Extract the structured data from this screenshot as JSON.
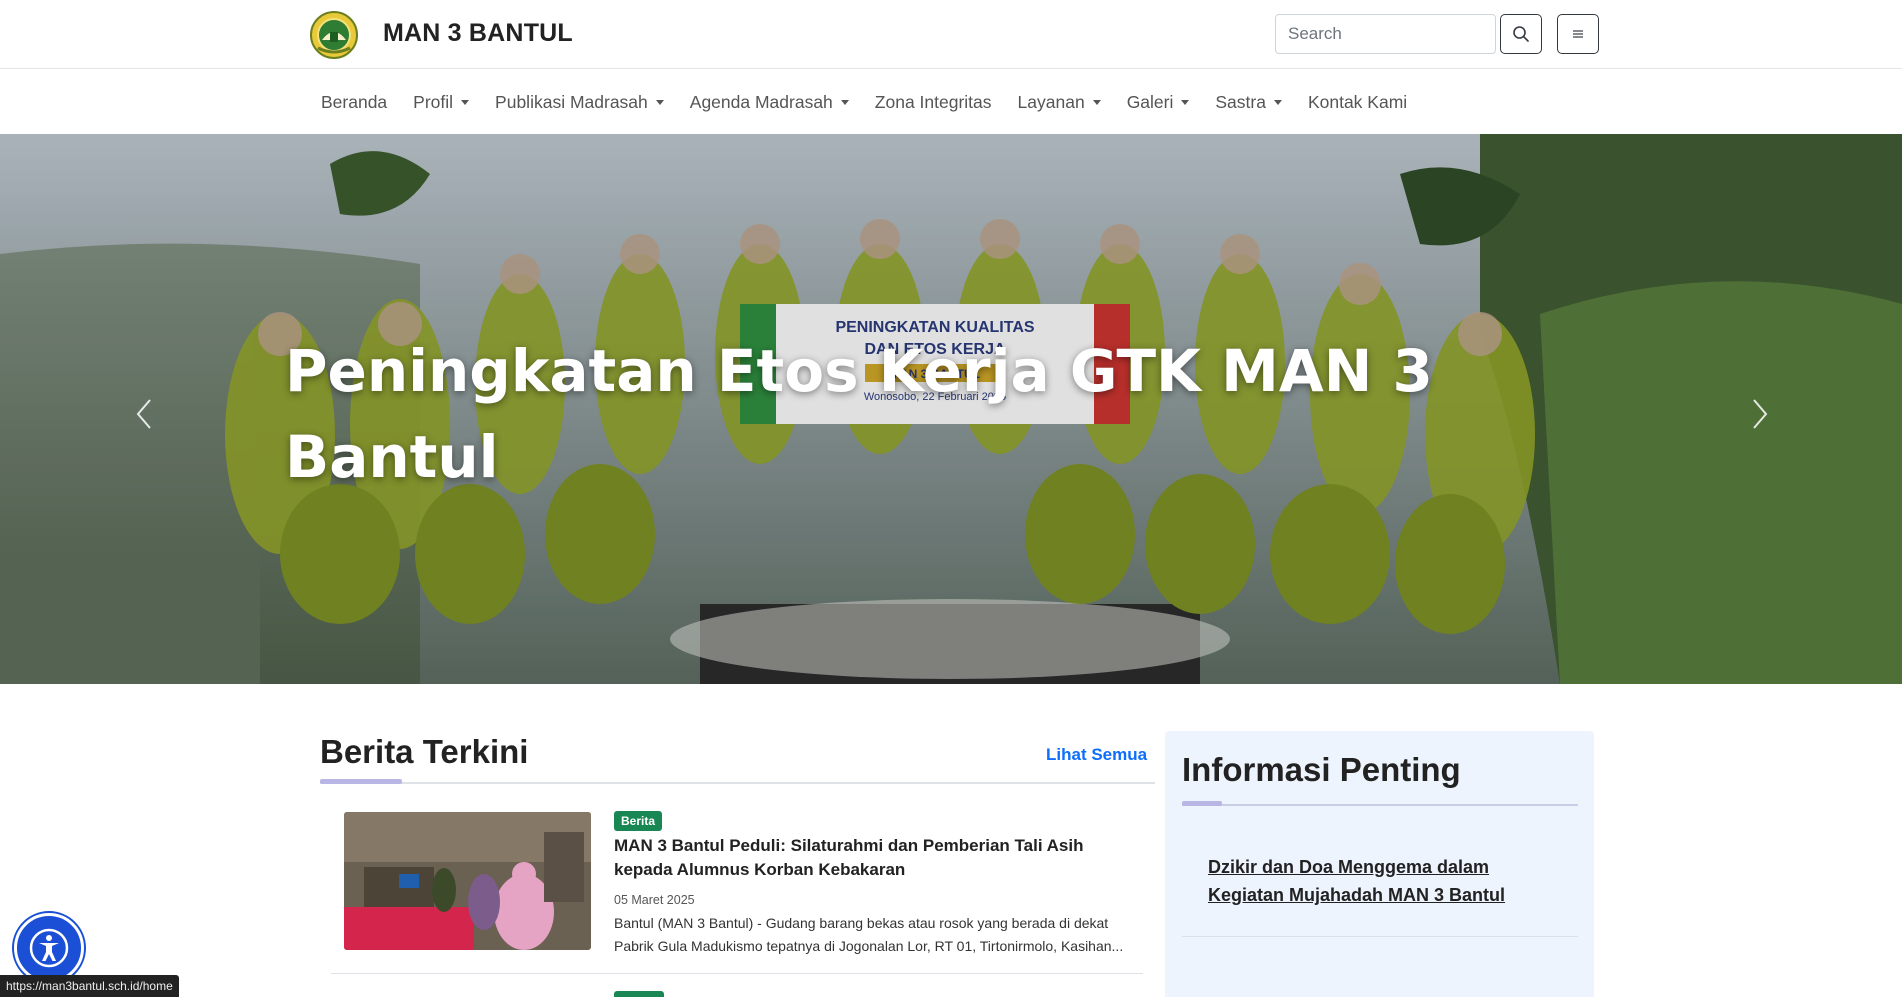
{
  "header": {
    "brand": "MAN 3 BANTUL",
    "search_placeholder": "Search"
  },
  "nav": {
    "items": [
      {
        "label": "Beranda",
        "dropdown": false
      },
      {
        "label": "Profil",
        "dropdown": true
      },
      {
        "label": "Publikasi Madrasah",
        "dropdown": true
      },
      {
        "label": "Agenda Madrasah",
        "dropdown": true
      },
      {
        "label": "Zona Integritas",
        "dropdown": false
      },
      {
        "label": "Layanan",
        "dropdown": true
      },
      {
        "label": "Galeri",
        "dropdown": true
      },
      {
        "label": "Sastra",
        "dropdown": true
      },
      {
        "label": "Kontak Kami",
        "dropdown": false
      }
    ]
  },
  "hero": {
    "title": "Peningkatan Etos Kerja GTK MAN 3 Bantul",
    "banner_line1": "PENINGKATAN KUALITAS",
    "banner_line2": "DAN ETOS KERJA",
    "banner_line3": "MAN 3 BANTUL",
    "banner_line4": "Wonosobo, 22 Februari 2025"
  },
  "news": {
    "section_title": "Berita Terkini",
    "see_all": "Lihat Semua",
    "items": [
      {
        "category": "Berita",
        "title": "MAN 3 Bantul Peduli: Silaturahmi dan Pemberian Tali Asih kepada Alumnus Korban Kebakaran",
        "date": "05 Maret 2025",
        "excerpt": "Bantul (MAN 3 Bantul) - Gudang barang bekas atau rosok yang berada di dekat Pabrik Gula Madukismo tepatnya di Jogonalan Lor, RT 01, Tirtonirmolo, Kasihan..."
      }
    ]
  },
  "info": {
    "title": "Informasi Penting",
    "items": [
      {
        "title": "Dzikir dan Doa Menggema dalam Kegiatan Mujahadah MAN 3 Bantul"
      }
    ]
  },
  "status_url": "https://man3bantul.sch.id/home",
  "colors": {
    "link": "#0d6efd",
    "badge": "#198754",
    "panel_bg": "#eef4fd",
    "accent": "#b9b6e6",
    "a11y": "#1a4fd6"
  },
  "icons": {
    "logo": "school-emblem",
    "search": "search-icon",
    "menu": "hamburger-icon",
    "prev": "chevron-left-icon",
    "next": "chevron-right-icon",
    "accessibility": "accessibility-icon"
  }
}
